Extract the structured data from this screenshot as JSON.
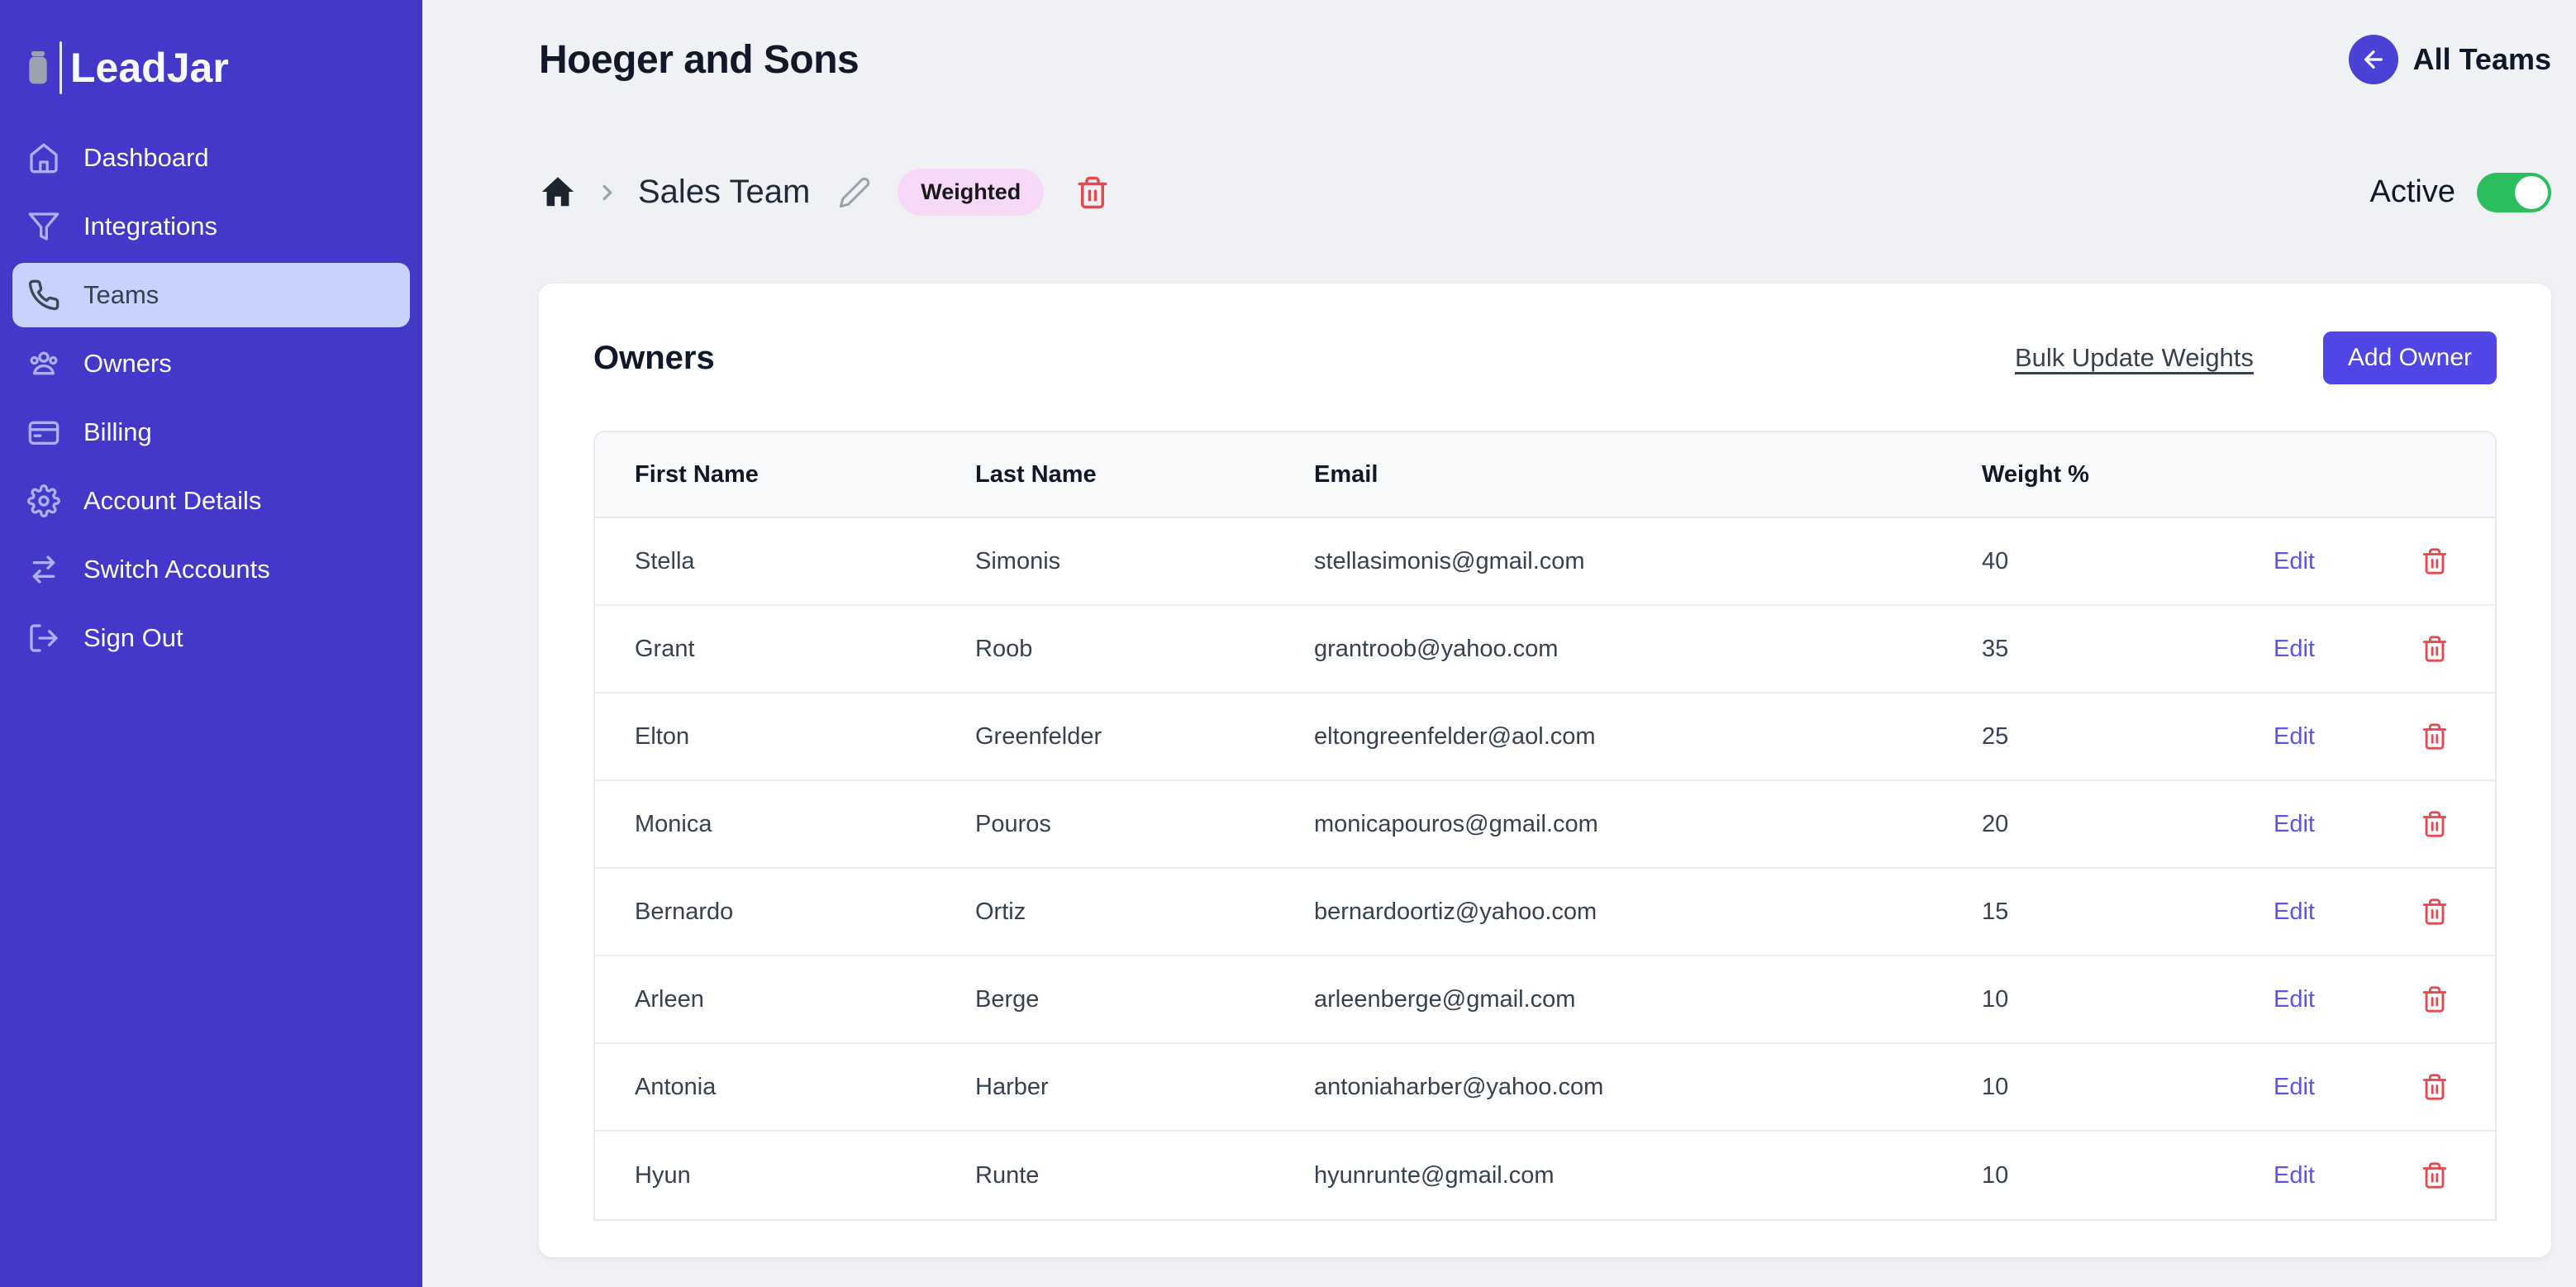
{
  "app": {
    "name": "LeadJar"
  },
  "sidebar": {
    "items": [
      {
        "label": "Dashboard",
        "icon": "home-icon",
        "active": false
      },
      {
        "label": "Integrations",
        "icon": "funnel-icon",
        "active": false
      },
      {
        "label": "Teams",
        "icon": "phone-icon",
        "active": true
      },
      {
        "label": "Owners",
        "icon": "users-icon",
        "active": false
      },
      {
        "label": "Billing",
        "icon": "credit-card-icon",
        "active": false
      },
      {
        "label": "Account Details",
        "icon": "gear-icon",
        "active": false
      },
      {
        "label": "Switch Accounts",
        "icon": "switch-arrows-icon",
        "active": false
      },
      {
        "label": "Sign Out",
        "icon": "sign-out-icon",
        "active": false
      }
    ]
  },
  "header": {
    "title": "Hoeger and Sons",
    "back_button_label": "All Teams"
  },
  "breadcrumb": {
    "team_name": "Sales Team",
    "badge": "Weighted"
  },
  "status": {
    "label": "Active",
    "enabled": true
  },
  "owners_card": {
    "title": "Owners",
    "bulk_update_label": "Bulk Update Weights",
    "add_owner_label": "Add Owner",
    "table": {
      "columns": [
        "First Name",
        "Last Name",
        "Email",
        "Weight %"
      ],
      "edit_label": "Edit",
      "rows": [
        {
          "first_name": "Stella",
          "last_name": "Simonis",
          "email": "stellasimonis@gmail.com",
          "weight": 40
        },
        {
          "first_name": "Grant",
          "last_name": "Roob",
          "email": "grantroob@yahoo.com",
          "weight": 35
        },
        {
          "first_name": "Elton",
          "last_name": "Greenfelder",
          "email": "eltongreenfelder@aol.com",
          "weight": 25
        },
        {
          "first_name": "Monica",
          "last_name": "Pouros",
          "email": "monicapouros@gmail.com",
          "weight": 20
        },
        {
          "first_name": "Bernardo",
          "last_name": "Ortiz",
          "email": "bernardoortiz@yahoo.com",
          "weight": 15
        },
        {
          "first_name": "Arleen",
          "last_name": "Berge",
          "email": "arleenberge@gmail.com",
          "weight": 10
        },
        {
          "first_name": "Antonia",
          "last_name": "Harber",
          "email": "antoniaharber@yahoo.com",
          "weight": 10
        },
        {
          "first_name": "Hyun",
          "last_name": "Runte",
          "email": "hyunrunte@gmail.com",
          "weight": 10
        }
      ]
    }
  },
  "colors": {
    "sidebar_bg": "#4438ca",
    "sidebar_active_bg": "#c7d2fe",
    "accent": "#4f46e5",
    "toggle_on": "#2cbe5e",
    "danger": "#e5484d",
    "badge_bg": "#f6d9f7",
    "edit_link": "#5b54e8",
    "main_bg": "#f0f1f4"
  }
}
